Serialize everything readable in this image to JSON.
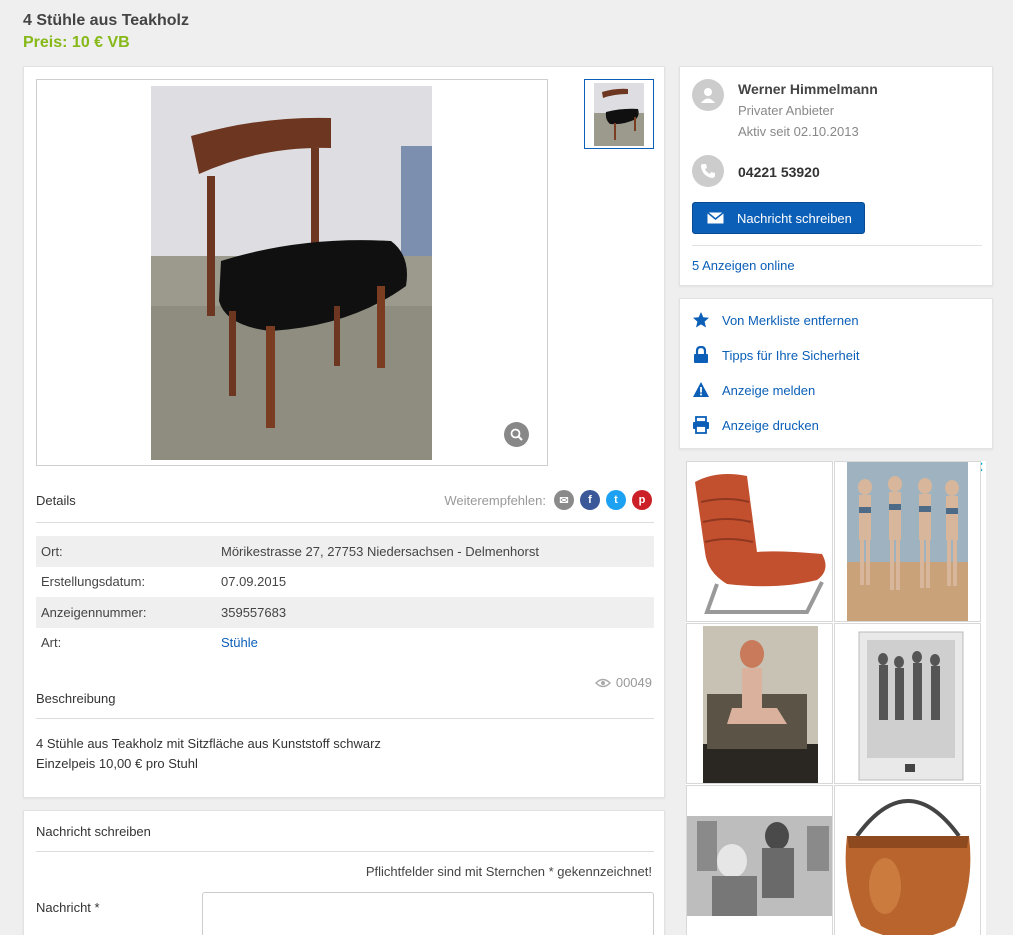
{
  "listing": {
    "title": "4 Stühle aus Teakholz",
    "price": "Preis: 10 € VB"
  },
  "details": {
    "heading": "Details",
    "share_label": "Weiterempfehlen:",
    "share_icons": [
      "email-icon",
      "facebook-icon",
      "twitter-icon",
      "pinterest-icon"
    ],
    "rows": [
      {
        "key": "Ort:",
        "value": "Mörikestrasse 27, 27753 Niedersachsen - Delmenhorst"
      },
      {
        "key": "Erstellungsdatum:",
        "value": "07.09.2015"
      },
      {
        "key": "Anzeigennummer:",
        "value": "359557683"
      },
      {
        "key": "Art:",
        "value": "Stühle"
      }
    ],
    "views": "00049"
  },
  "description": {
    "heading": "Beschreibung",
    "line1": "4 Stühle aus Teakholz mit Sitzfläche aus Kunststoff schwarz",
    "line2": "Einzelpeis 10,00 € pro Stuhl"
  },
  "message_form": {
    "heading": "Nachricht schreiben",
    "required_note": "Pflichtfelder sind mit Sternchen * gekennzeichnet!",
    "message_label": "Nachricht *",
    "message_value": ""
  },
  "seller": {
    "name": "Werner Himmelmann",
    "type": "Privater Anbieter",
    "active_since": "Aktiv seit 02.10.2013",
    "phone": "04221 53920",
    "message_button": "Nachricht schreiben",
    "ads_online": "5 Anzeigen online"
  },
  "actions": [
    {
      "label": "Von Merkliste entfernen",
      "icon": "star-icon"
    },
    {
      "label": "Tipps für Ihre Sicherheit",
      "icon": "lock-icon"
    },
    {
      "label": "Anzeige melden",
      "icon": "warning-icon"
    },
    {
      "label": "Anzeige drucken",
      "icon": "print-icon"
    }
  ],
  "colors": {
    "accent": "#0b5fb7",
    "price": "#86b817",
    "background": "#efefef"
  }
}
